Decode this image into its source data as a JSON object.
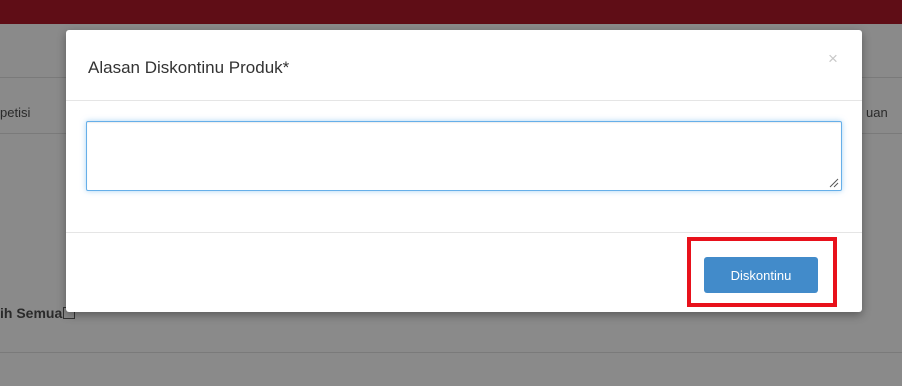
{
  "background": {
    "left_column_text": "petisi",
    "right_column_text": "uan",
    "select_all_label": "ih Semua"
  },
  "modal": {
    "title": "Alasan Diskontinu Produk*",
    "close_glyph": "×",
    "reason_value": "",
    "submit_label": "Diskontinu"
  },
  "colors": {
    "topbar": "#5f0d16",
    "primary_button": "#428bca",
    "highlight": "#e8111b",
    "focus_border": "#66afe9"
  }
}
